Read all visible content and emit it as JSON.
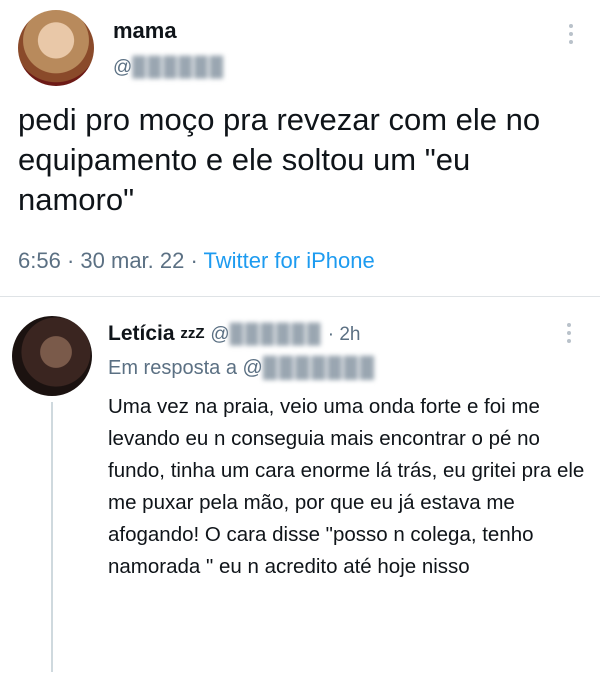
{
  "tweet": {
    "author_name": "mama",
    "handle": "@…",
    "handle_obscured": "██████",
    "text": "pedi pro moço pra revezar com ele no equipamento e ele soltou um \"eu namoro\"",
    "time": "6:56",
    "date": "30 mar. 22",
    "source": "Twitter for iPhone",
    "separator": "·"
  },
  "reply": {
    "author_name": "Letícia",
    "name_suffix": "zzZ",
    "handle_prefix": "@",
    "handle_obscured": "██████",
    "age": "2h",
    "reply_label": "Em resposta a",
    "reply_to_prefix": "@",
    "reply_to_obscured": "███████",
    "text": "Uma vez na praia, veio uma onda forte e foi me levando eu n conseguia mais encontrar o pé no fundo, tinha um cara enorme lá trás, eu gritei pra ele me puxar pela mão, por que eu já estava me afogando! O cara disse \"posso n colega, tenho namorada \" eu n acredito até hoje nisso"
  },
  "colors": {
    "text": "#0f1419",
    "secondary": "#5b7083",
    "link": "#1d9bf0",
    "divider": "#dfe3e6"
  },
  "icons": [
    "more-icon",
    "more-icon"
  ]
}
